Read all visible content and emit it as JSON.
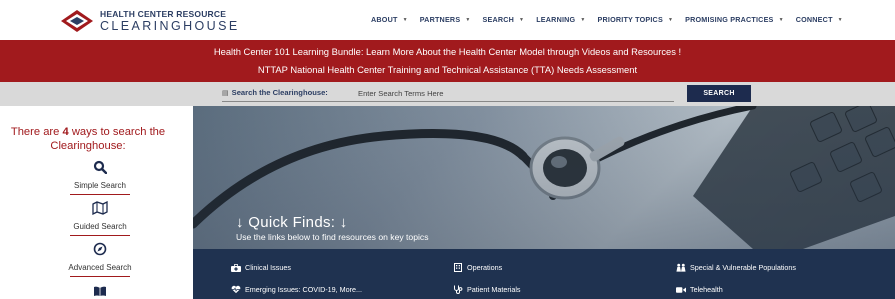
{
  "header": {
    "logo_line1": "HEALTH CENTER RESOURCE",
    "logo_line2": "CLEARINGHOUSE",
    "nav": [
      {
        "label": "ABOUT"
      },
      {
        "label": "PARTNERS"
      },
      {
        "label": "SEARCH"
      },
      {
        "label": "LEARNING"
      },
      {
        "label": "PRIORITY TOPICS"
      },
      {
        "label": "PROMISING PRACTICES"
      },
      {
        "label": "CONNECT"
      }
    ]
  },
  "announcements": [
    "Health Center 101 Learning Bundle: Learn More About the Health Center Model through Videos and Resources !",
    "NTTAP National Health Center Training and Technical Assistance (TTA) Needs Assessment"
  ],
  "search": {
    "label": "Search the Clearinghouse:",
    "placeholder": "Enter Search Terms Here",
    "button_label": "SEARCH"
  },
  "sidebar": {
    "intro_prefix": "There are",
    "intro_count": "4",
    "intro_suffix": "ways to search the Clearinghouse:",
    "ways": [
      {
        "label": "Simple Search",
        "icon": "search-icon"
      },
      {
        "label": "Guided Search",
        "icon": "map-icon"
      },
      {
        "label": "Advanced Search",
        "icon": "compass-icon"
      },
      {
        "label": "",
        "icon": "book-icon"
      }
    ]
  },
  "hero": {
    "title": "↓ Quick Finds: ↓",
    "subtitle": "Use the links below to find resources on key topics"
  },
  "quick_finds": [
    {
      "label": "Clinical Issues",
      "icon": "medical-kit-icon"
    },
    {
      "label": "Operations",
      "icon": "building-icon"
    },
    {
      "label": "Special & Vulnerable Populations",
      "icon": "people-icon"
    },
    {
      "label": "Emerging Issues: COVID-19, More...",
      "icon": "heartbeat-icon"
    },
    {
      "label": "Patient Materials",
      "icon": "stethoscope-icon"
    },
    {
      "label": "Telehealth",
      "icon": "video-camera-icon"
    }
  ],
  "colors": {
    "brand_red": "#a11a1d",
    "brand_navy": "#1d2b4e",
    "quickfind_bg": "#1f3250",
    "searchbar_bg": "#d9d9d9"
  }
}
